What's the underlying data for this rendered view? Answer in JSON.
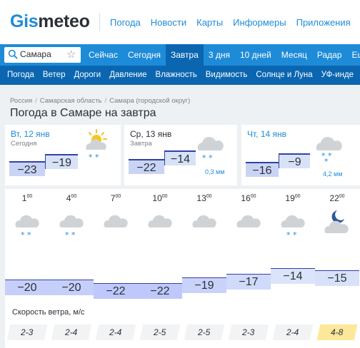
{
  "header": {
    "logo_part1": "Gis",
    "logo_part2": "meteo",
    "nav": [
      "Погода",
      "Новости",
      "Карты",
      "Информеры",
      "Приложения"
    ]
  },
  "search": {
    "value": "Самара",
    "icon": "search-icon",
    "fav_icon": "star-icon"
  },
  "tabs": [
    "Сейчас",
    "Сегодня",
    "Завтра",
    "3 дня",
    "10 дней",
    "Месяц",
    "Радар",
    "Eu"
  ],
  "active_tab": "Завтра",
  "subnav": [
    "Погода",
    "Ветер",
    "Дороги",
    "Давление",
    "Влажность",
    "Видимость",
    "Солнце и Луна",
    "УФ-инде"
  ],
  "breadcrumb": [
    "Россия",
    "Самарская область",
    "Самара (городской округ)"
  ],
  "title": "Погода в Самаре на завтра",
  "days": [
    {
      "date": "Вт, 12 янв",
      "sub": "Сегодня",
      "min": "−23",
      "max": "−19",
      "precip": "",
      "icon": "partly-cloudy-snow-icon",
      "date_color": "#1e8bd8"
    },
    {
      "date": "Ср, 13 янв",
      "sub": "Завтра",
      "min": "−22",
      "max": "−14",
      "precip": "0,3 мм",
      "icon": "cloudy-snow-icon",
      "date_color": "#2b3037"
    },
    {
      "date": "Чт, 14 янв",
      "sub": "",
      "min": "−16",
      "max": "−9",
      "precip": "4,2 мм",
      "icon": "cloudy-snow-icon",
      "date_color": "#1e8bd8"
    }
  ],
  "hourly": {
    "hours": [
      "1",
      "4",
      "7",
      "10",
      "13",
      "16",
      "19",
      "22"
    ],
    "minutes": "00",
    "icons": [
      "cloudy-snow-icon",
      "cloudy-snow-icon",
      "cloudy-icon",
      "cloudy-icon",
      "cloudy-icon",
      "cloudy-icon",
      "cloudy-snow-icon",
      "night-cloudy-icon"
    ],
    "temps": [
      "−20",
      "−20",
      "−22",
      "−22",
      "−19",
      "−17",
      "−14",
      "−15"
    ],
    "temp_values": [
      -20,
      -20,
      -22,
      -22,
      -19,
      -17,
      -14,
      -15
    ],
    "wind_label": "Скорость ветра, м/с",
    "wind": [
      "2-3",
      "2-4",
      "2-4",
      "2-5",
      "2-5",
      "2-3",
      "2-4",
      "4-8"
    ],
    "wind_strong": [
      false,
      false,
      false,
      false,
      false,
      false,
      false,
      true
    ]
  },
  "colors": {
    "brand": "#1e8bd8",
    "nav_dark": "#0b66b1",
    "temp_line": "#3340a4",
    "wind_strong": "#fbe89a"
  }
}
